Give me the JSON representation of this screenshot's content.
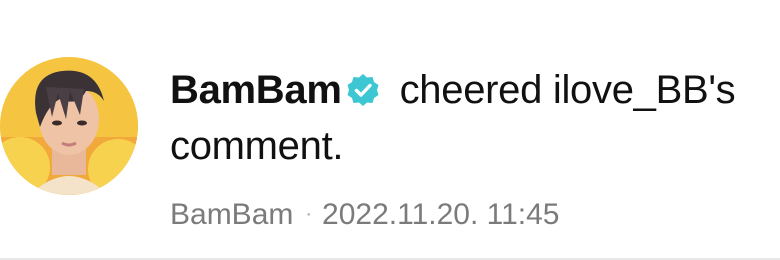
{
  "notification": {
    "actor": "BamBam",
    "actor_verified": true,
    "action_text": "cheered ilove_BB's comment.",
    "meta_author": "BamBam",
    "meta_separator": "·",
    "timestamp": "2022.11.20. 11:45",
    "avatar_icon": "user-avatar",
    "verified_icon": "verified-badge-icon",
    "colors": {
      "verified_badge": "#3cc7d3",
      "text_primary": "#111111",
      "text_meta": "#7b7b7b"
    }
  }
}
